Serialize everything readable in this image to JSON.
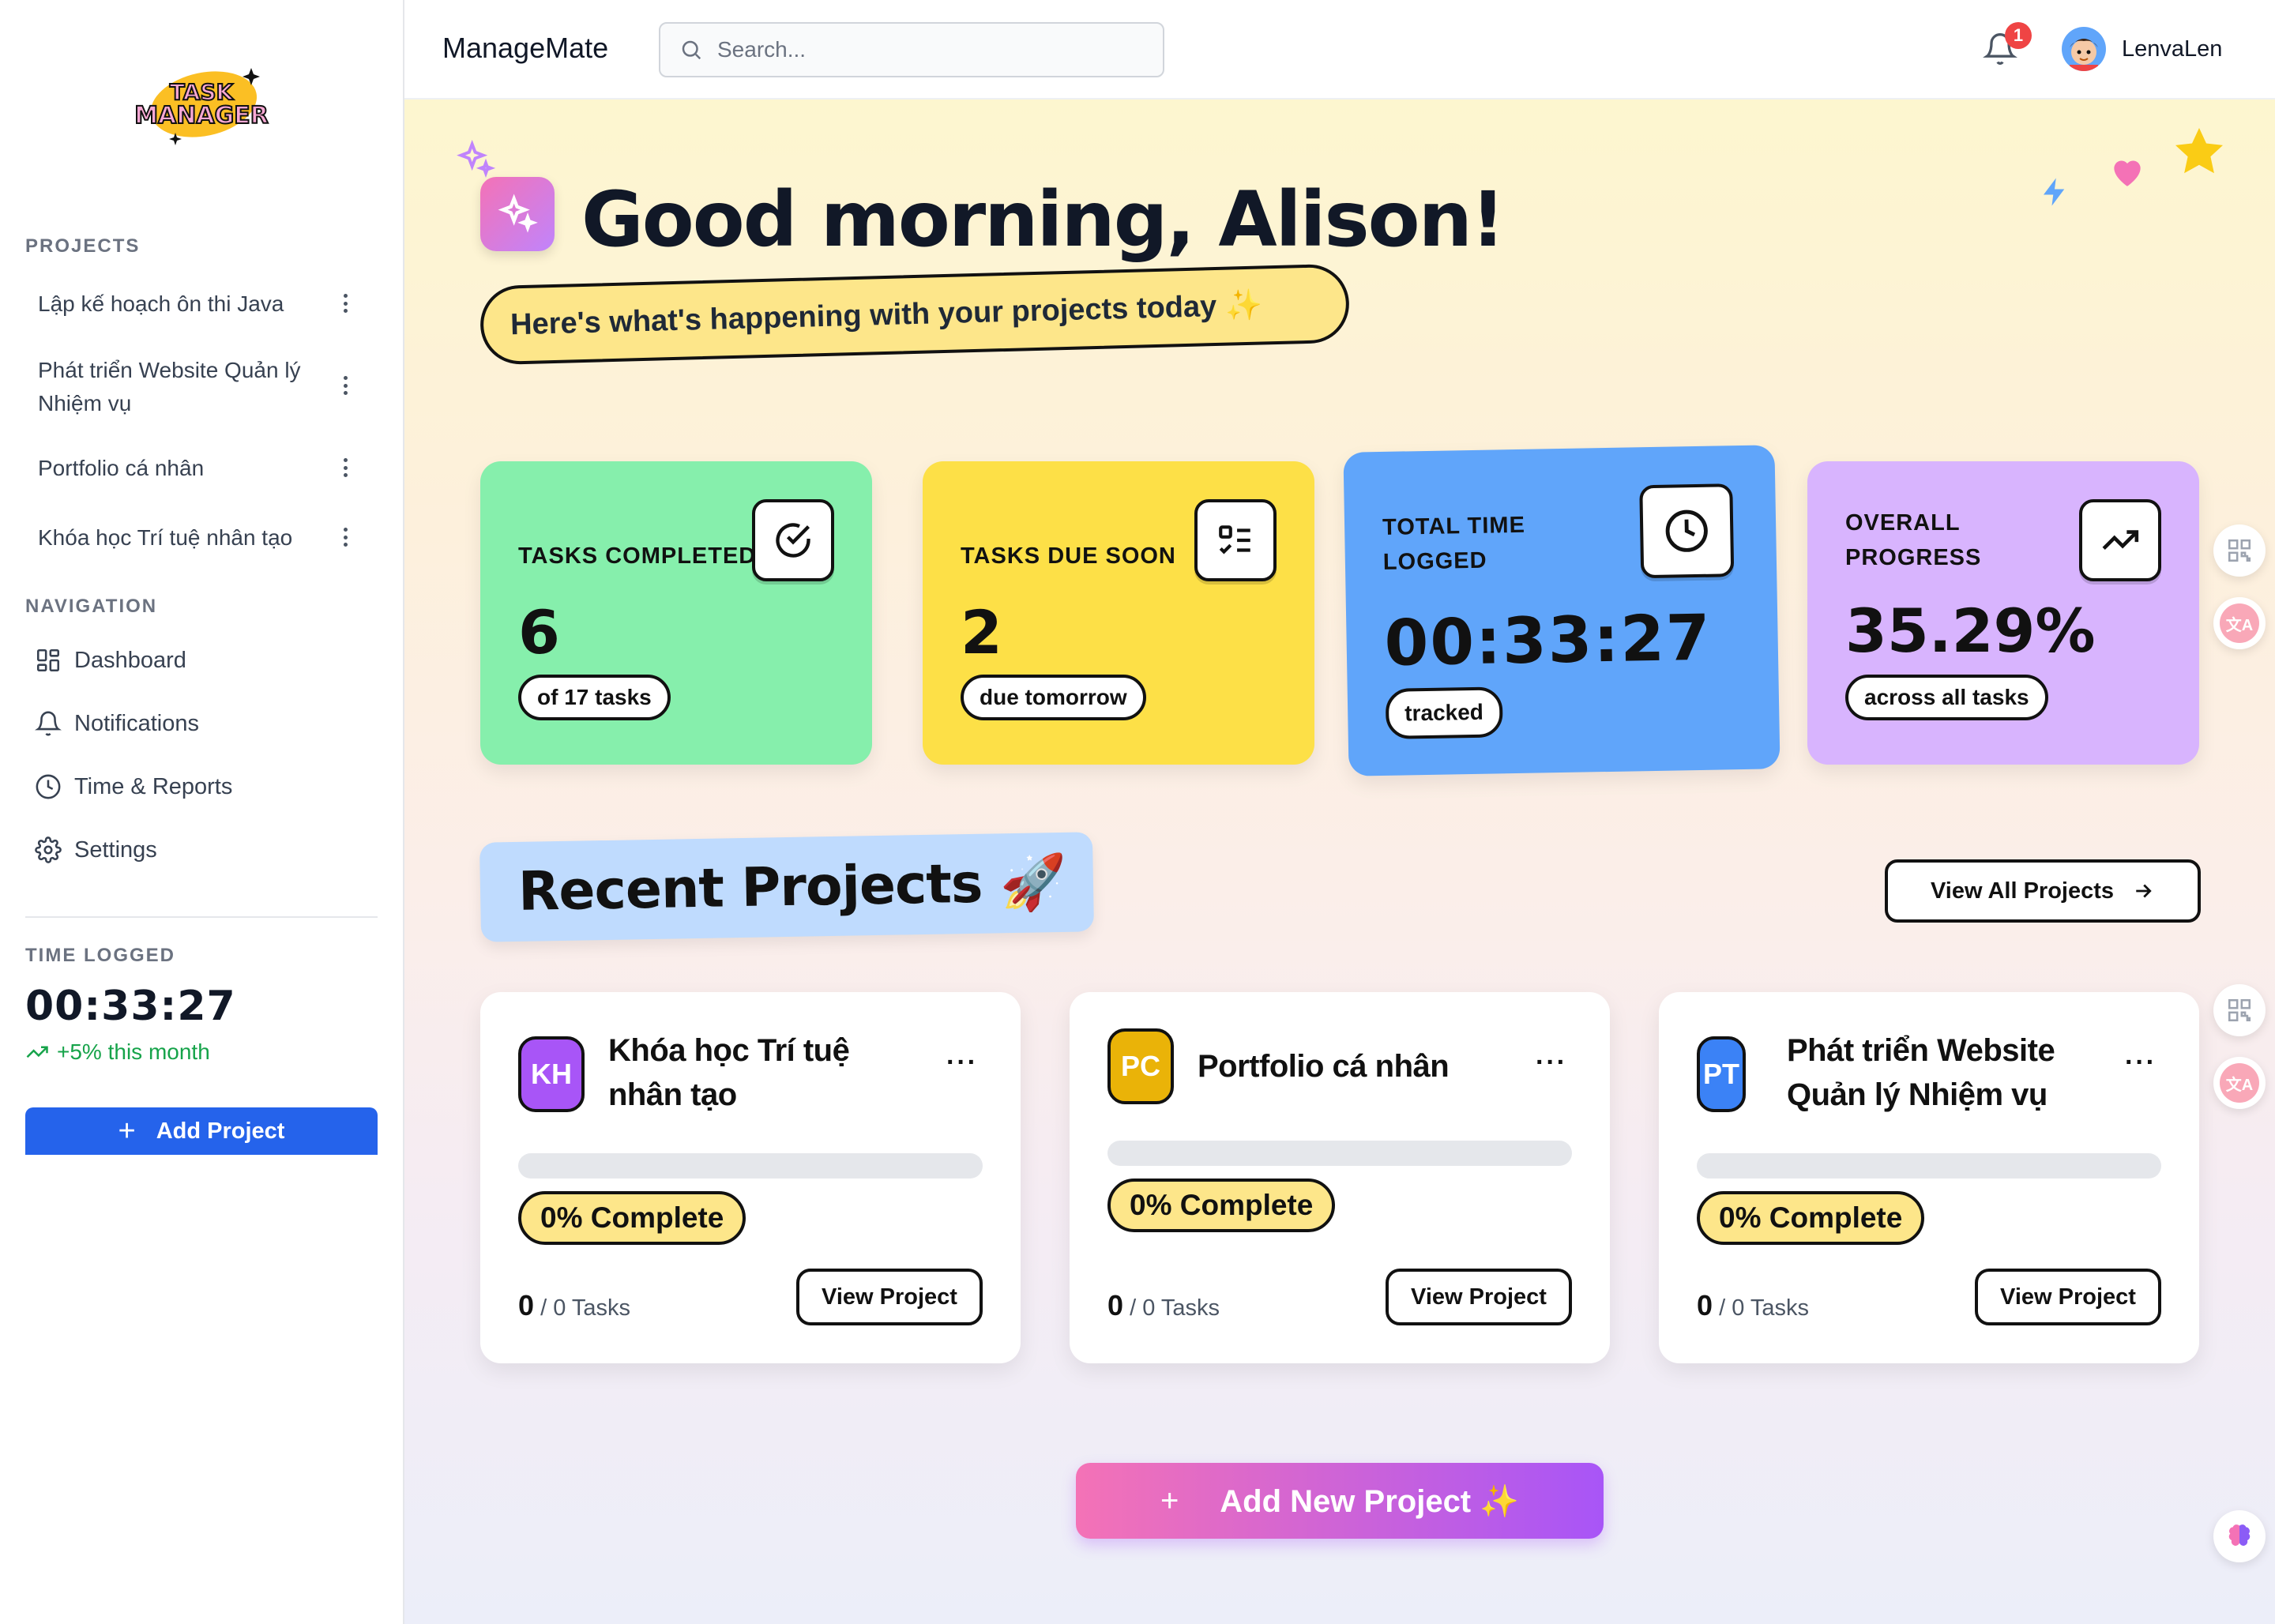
{
  "sidebar": {
    "logo_text": "TASK MANAGER",
    "projects_label": "PROJECTS",
    "projects": [
      {
        "label": "Lập kế hoạch ôn thi Java"
      },
      {
        "label": "Phát triển Website Quản lý Nhiệm vụ"
      },
      {
        "label": "Portfolio cá nhân"
      },
      {
        "label": "Khóa học Trí tuệ nhân tạo"
      }
    ],
    "navigation_label": "NAVIGATION",
    "nav": [
      {
        "label": "Dashboard",
        "icon": "dashboard-grid-icon"
      },
      {
        "label": "Notifications",
        "icon": "bell-icon"
      },
      {
        "label": "Time & Reports",
        "icon": "clock-icon"
      },
      {
        "label": "Settings",
        "icon": "gear-icon"
      }
    ],
    "time_logged_label": "TIME LOGGED",
    "time_logged_value": "00:33:27",
    "time_trend": "+5% this month",
    "add_project_label": "Add Project"
  },
  "topbar": {
    "app_name": "ManageMate",
    "search_placeholder": "Search...",
    "notification_count": "1",
    "username": "LenvaLen"
  },
  "hero": {
    "greeting": "Good morning, Alison!",
    "subtitle": "Here's what's happening with your projects today ✨"
  },
  "stats": [
    {
      "label": "TASKS COMPLETED",
      "value": "6",
      "sub": "of 17 tasks",
      "icon": "check-circle-icon",
      "color": "#86efac"
    },
    {
      "label": "TASKS DUE SOON",
      "value": "2",
      "sub": "due tomorrow",
      "icon": "checklist-icon",
      "color": "#fde047"
    },
    {
      "label": "TOTAL TIME LOGGED",
      "value": "00:33:27",
      "sub": "tracked",
      "icon": "clock-icon",
      "color": "#60a5fa"
    },
    {
      "label": "OVERALL PROGRESS",
      "value": "35.29%",
      "sub": "across all tasks",
      "icon": "trending-up-icon",
      "color": "#d8b4fe"
    }
  ],
  "recent": {
    "title": "Recent Projects 🚀",
    "view_all_label": "View All Projects"
  },
  "project_cards": [
    {
      "initials": "KH",
      "name": "Khóa học Trí tuệ nhân tạo",
      "color": "#a855f7",
      "progress": 0,
      "percent_label": "0% Complete",
      "done": "0",
      "total": "/ 0 Tasks",
      "button": "View Project"
    },
    {
      "initials": "PC",
      "name": "Portfolio cá nhân",
      "color": "#eab308",
      "progress": 0,
      "percent_label": "0% Complete",
      "done": "0",
      "total": "/ 0 Tasks",
      "button": "View Project"
    },
    {
      "initials": "PT",
      "name": "Phát triển Website Quản lý Nhiệm vụ",
      "color": "#3b82f6",
      "progress": 0,
      "percent_label": "0% Complete",
      "done": "0",
      "total": "/ 0 Tasks",
      "button": "View Project"
    }
  ],
  "add_new_project_label": "Add New Project ✨",
  "colors": {
    "primary": "#2563eb",
    "accent_pink": "#f472b6",
    "accent_purple": "#a855f7"
  }
}
